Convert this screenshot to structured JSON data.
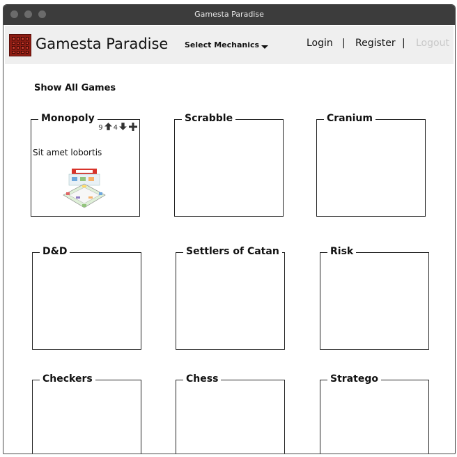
{
  "window": {
    "title": "Gamesta Paradise"
  },
  "navbar": {
    "brand": "Gamesta Paradise",
    "mechanics_select": "Select Mechanics",
    "login": "Login",
    "register": "Register",
    "logout": "Logout",
    "separator": "|"
  },
  "main": {
    "show_all": "Show All Games",
    "games": [
      {
        "name": "Monopoly",
        "upvotes": "9",
        "downvotes": "4",
        "description": "Sit amet lobortis"
      },
      {
        "name": "Scrabble"
      },
      {
        "name": "Cranium"
      },
      {
        "name": "D&D"
      },
      {
        "name": "Settlers of Catan"
      },
      {
        "name": "Risk"
      },
      {
        "name": "Checkers"
      },
      {
        "name": "Chess"
      },
      {
        "name": "Stratego"
      }
    ]
  }
}
